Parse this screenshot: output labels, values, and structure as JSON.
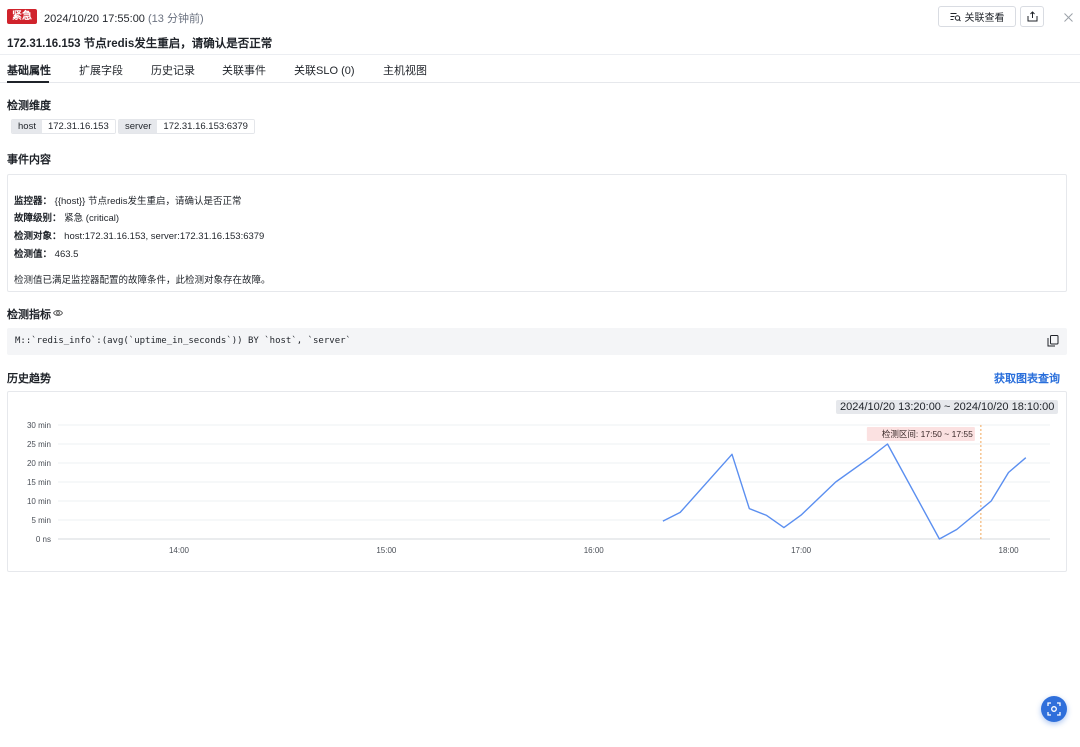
{
  "header": {
    "severity": "紧急",
    "time": "2024/10/20 17:55:00",
    "relative_time": "(13 分钟前)",
    "title": "172.31.16.153 节点redis发生重启，请确认是否正常",
    "related_view_label": "关联查看",
    "severity_color": "#d0232c"
  },
  "tabs": [
    {
      "label": "基础属性"
    },
    {
      "label": "扩展字段"
    },
    {
      "label": "历史记录"
    },
    {
      "label": "关联事件"
    },
    {
      "label": "关联SLO (0)"
    },
    {
      "label": "主机视图"
    }
  ],
  "dimensions": {
    "title": "检测维度",
    "tags": [
      {
        "key": "host",
        "value": "172.31.16.153"
      },
      {
        "key": "server",
        "value": "172.31.16.153:6379"
      }
    ]
  },
  "event_content": {
    "title": "事件内容",
    "lines": [
      {
        "label": "监控器：",
        "value": "{{host}} 节点redis发生重启，请确认是否正常"
      },
      {
        "label": "故障级别：",
        "value": "紧急 (critical)"
      },
      {
        "label": "检测对象：",
        "value": "host:172.31.16.153, server:172.31.16.153:6379"
      },
      {
        "label": "检测值：",
        "value": "463.5"
      }
    ],
    "summary": "检测值已满足监控器配置的故障条件，此检测对象存在故障。"
  },
  "metric": {
    "title": "检测指标",
    "query": "M::`redis_info`:(avg(`uptime_in_seconds`)) BY `host`, `server`"
  },
  "history": {
    "title": "历史趋势",
    "get_chart_link": "获取图表查询",
    "time_range": "2024/10/20 13:20:00 ~ 2024/10/20 18:10:00",
    "detect_label": "检测区间: 17:50 ~ 17:55"
  },
  "chart_data": {
    "type": "line",
    "title": "",
    "xlabel": "",
    "ylabel": "",
    "y_ticks": [
      "30 min",
      "25 min",
      "20 min",
      "15 min",
      "10 min",
      "5 min",
      "0 ns"
    ],
    "y_tick_values": [
      30,
      25,
      20,
      15,
      10,
      5,
      0
    ],
    "x_ticks": [
      "14:00",
      "15:00",
      "16:00",
      "17:00",
      "18:00"
    ],
    "x_tick_values": [
      "14:00",
      "15:00",
      "16:00",
      "17:00",
      "18:00"
    ],
    "x_range": [
      "13:25",
      "18:12"
    ],
    "ylim": [
      0,
      30
    ],
    "grid": true,
    "line_color": "#5b8ff0",
    "detect_line_color": "#f0a85a",
    "detect_time": "17:52",
    "series": [
      {
        "x": [
          "16:20",
          "16:25",
          "16:40",
          "16:45",
          "16:50",
          "16:55",
          "17:00",
          "17:10",
          "17:20",
          "17:25",
          "17:40",
          "17:45",
          "17:55",
          "18:00",
          "18:05"
        ],
        "y": [
          4.7,
          7.0,
          22.3,
          8.0,
          6.2,
          3.0,
          6.3,
          15.0,
          21.5,
          25.0,
          0.0,
          2.5,
          10.0,
          17.5,
          21.4
        ]
      }
    ]
  }
}
